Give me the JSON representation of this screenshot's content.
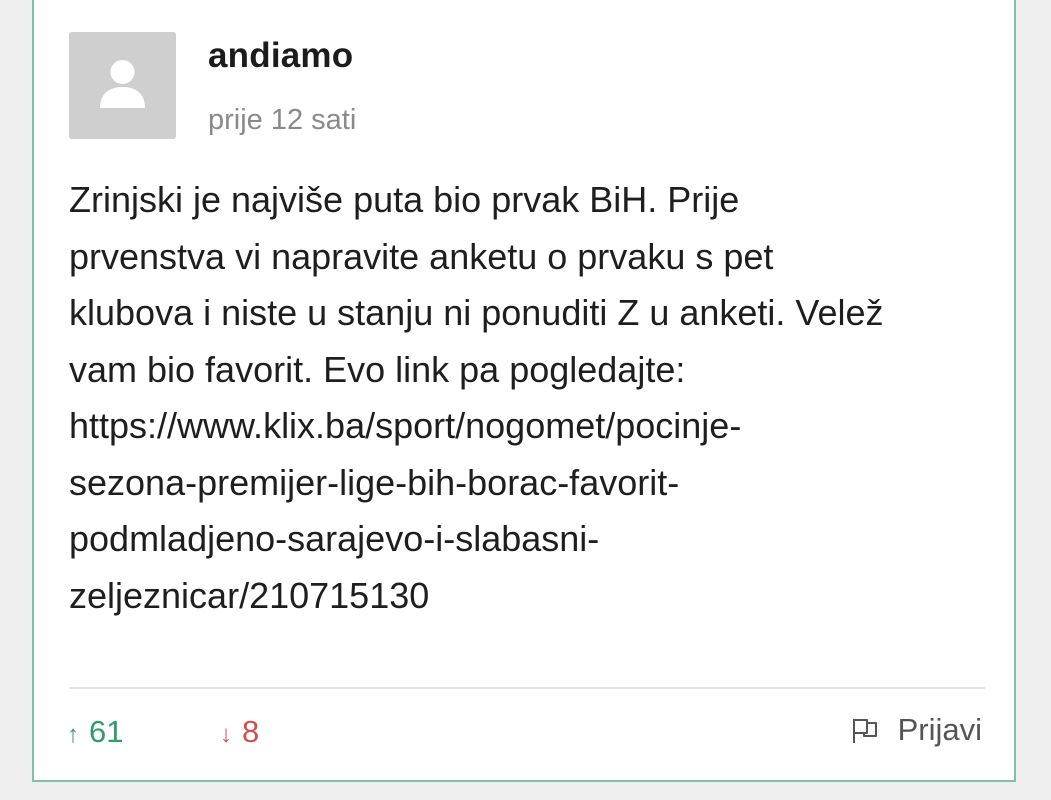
{
  "comment": {
    "username": "andiamo",
    "timestamp": "prije 12 sati",
    "text": "Zrinjski je najviše puta bio prvak BiH. Prije\nprvenstva vi napravite anketu o prvaku s pet\nklubova i niste u stanju ni ponuditi Z u anketi. Velež\nvam bio favorit. Evo link pa pogledajte:\nhttps://www.klix.ba/sport/nogomet/pocinje-\nsezona-premijer-lige-bih-borac-favorit-\npodmladjeno-sarajevo-i-slabasni-\nzeljeznicar/210715130",
    "upvotes": "61",
    "downvotes": "8",
    "upvote_arrow": "↑",
    "downvote_arrow": "↓",
    "report_label": "Prijavi"
  },
  "icons": {
    "avatar": "user-placeholder-icon",
    "report": "flag-icon"
  },
  "colors": {
    "card_border": "#7ec3a8",
    "upvote": "#2e9c6b",
    "downvote": "#d0504d",
    "muted": "#8a8a8a"
  }
}
